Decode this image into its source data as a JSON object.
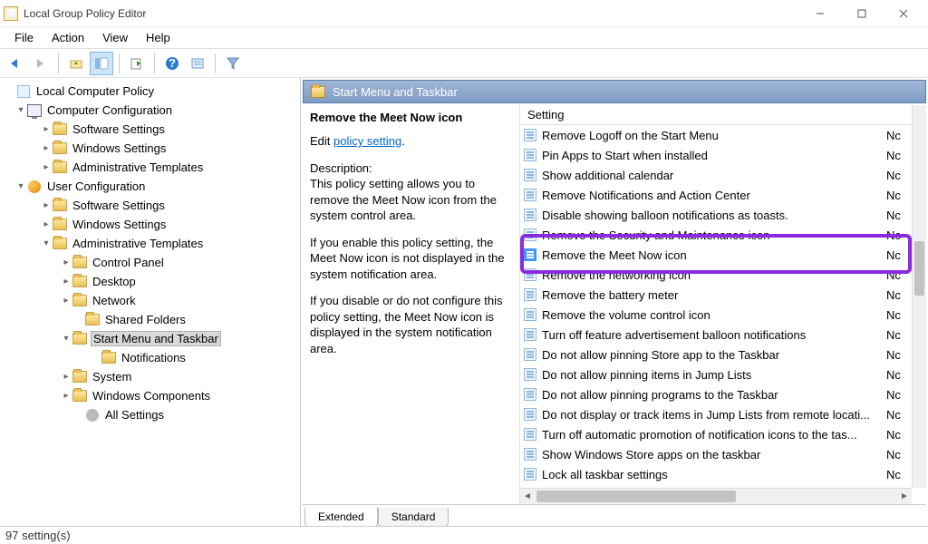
{
  "window": {
    "title": "Local Group Policy Editor"
  },
  "menu": {
    "file": "File",
    "action": "Action",
    "view": "View",
    "help": "Help"
  },
  "tree": {
    "root": "Local Computer Policy",
    "comp_config": "Computer Configuration",
    "comp_software": "Software Settings",
    "comp_windows": "Windows Settings",
    "comp_admin": "Administrative Templates",
    "user_config": "User Configuration",
    "user_software": "Software Settings",
    "user_windows": "Windows Settings",
    "user_admin": "Administrative Templates",
    "control_panel": "Control Panel",
    "desktop": "Desktop",
    "network": "Network",
    "shared_folders": "Shared Folders",
    "start_menu": "Start Menu and Taskbar",
    "notifications": "Notifications",
    "system": "System",
    "win_components": "Windows Components",
    "all_settings": "All Settings"
  },
  "section": {
    "title": "Start Menu and Taskbar"
  },
  "desc": {
    "heading": "Remove the Meet Now icon",
    "edit_prefix": "Edit ",
    "edit_link": "policy setting",
    "label": "Description:",
    "p1": "This policy setting allows you to remove the Meet Now icon from the system control area.",
    "p2": "If you enable this policy setting, the Meet Now icon is not displayed in the system notification area.",
    "p3": "If you disable or do not configure this policy setting, the Meet Now icon is displayed in the system notification area."
  },
  "list": {
    "header_setting": "Setting",
    "rows": [
      "Remove Logoff on the Start Menu",
      "Pin Apps to Start when installed",
      "Show additional calendar",
      "Remove Notifications and Action Center",
      "Disable showing balloon notifications as toasts.",
      "Remove the Security and Maintenance icon",
      "Remove the Meet Now icon",
      "Remove the networking icon",
      "Remove the battery meter",
      "Remove the volume control icon",
      "Turn off feature advertisement balloon notifications",
      "Do not allow pinning Store app to the Taskbar",
      "Do not allow pinning items in Jump Lists",
      "Do not allow pinning programs to the Taskbar",
      "Do not display or track items in Jump Lists from remote locati...",
      "Turn off automatic promotion of notification icons to the tas...",
      "Show Windows Store apps on the taskbar",
      "Lock all taskbar settings"
    ],
    "state_short": "Nc",
    "selected_index": 6
  },
  "tabs": {
    "extended": "Extended",
    "standard": "Standard"
  },
  "status": {
    "text": "97 setting(s)"
  }
}
